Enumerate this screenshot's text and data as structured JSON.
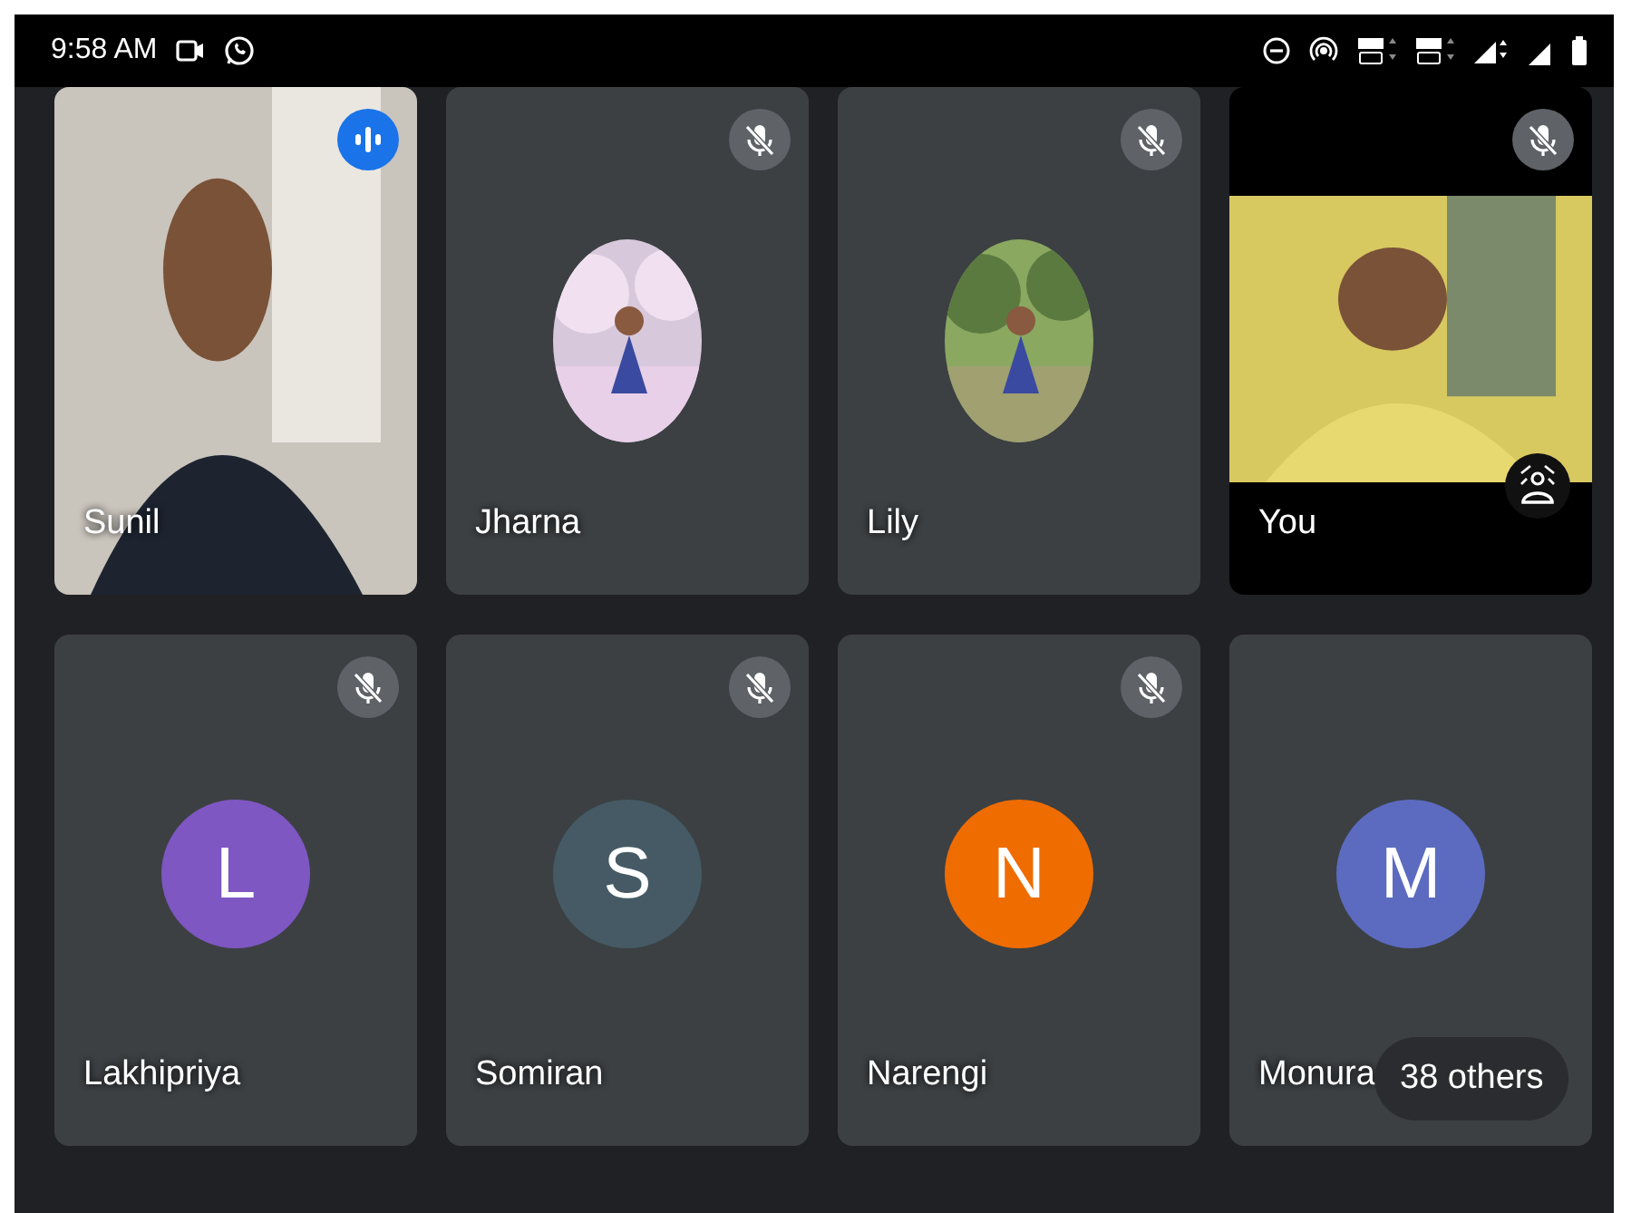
{
  "status_bar": {
    "time": "9:58 AM"
  },
  "tiles": [
    {
      "name": "Sunil",
      "kind": "video",
      "speaking": true
    },
    {
      "name": "Jharna",
      "muted": true,
      "speaking": false
    },
    {
      "name": "Lily",
      "muted": true,
      "speaking": false
    },
    {
      "name": "You",
      "kind": "self_video",
      "muted": true,
      "speaking": false
    },
    {
      "name": "Lakhipriya",
      "kind": "initial",
      "initial": "L",
      "color": "#7e57c2",
      "muted": true,
      "speaking": false
    },
    {
      "name": "Somiran",
      "kind": "initial",
      "initial": "S",
      "color": "#455a64",
      "muted": true,
      "speaking": false
    },
    {
      "name": "Narengi",
      "kind": "initial",
      "initial": "N",
      "color": "#ef6c00",
      "muted": true,
      "speaking": false
    },
    {
      "name": "Monura",
      "kind": "initial",
      "initial": "M",
      "color": "#5c6bc0",
      "muted": false,
      "speaking": false
    }
  ],
  "overflow": {
    "label": "38 others"
  }
}
